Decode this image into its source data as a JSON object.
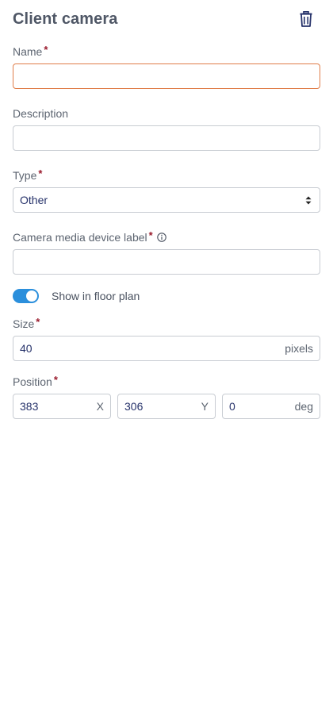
{
  "header": {
    "title": "Client camera"
  },
  "name": {
    "label": "Name",
    "required": "*",
    "value": ""
  },
  "description": {
    "label": "Description",
    "value": ""
  },
  "type": {
    "label": "Type",
    "required": "*",
    "value": "Other"
  },
  "camera_label": {
    "label": "Camera media device label",
    "required": "*",
    "value": ""
  },
  "floor_plan": {
    "label": "Show in floor plan",
    "enabled": true
  },
  "size": {
    "label": "Size",
    "required": "*",
    "value": "40",
    "unit": "pixels"
  },
  "position": {
    "label": "Position",
    "required": "*",
    "x": {
      "value": "383",
      "unit": "X"
    },
    "y": {
      "value": "306",
      "unit": "Y"
    },
    "rotation": {
      "value": "0",
      "unit": "deg"
    }
  },
  "colors": {
    "accent": "#2b8fdc",
    "focus_border": "#e07d49",
    "required": "#9a1b2d",
    "value_text": "#26326a"
  },
  "icons": {
    "delete": "trash-icon",
    "info": "info-circle-icon",
    "select": "sort-arrows-icon"
  }
}
